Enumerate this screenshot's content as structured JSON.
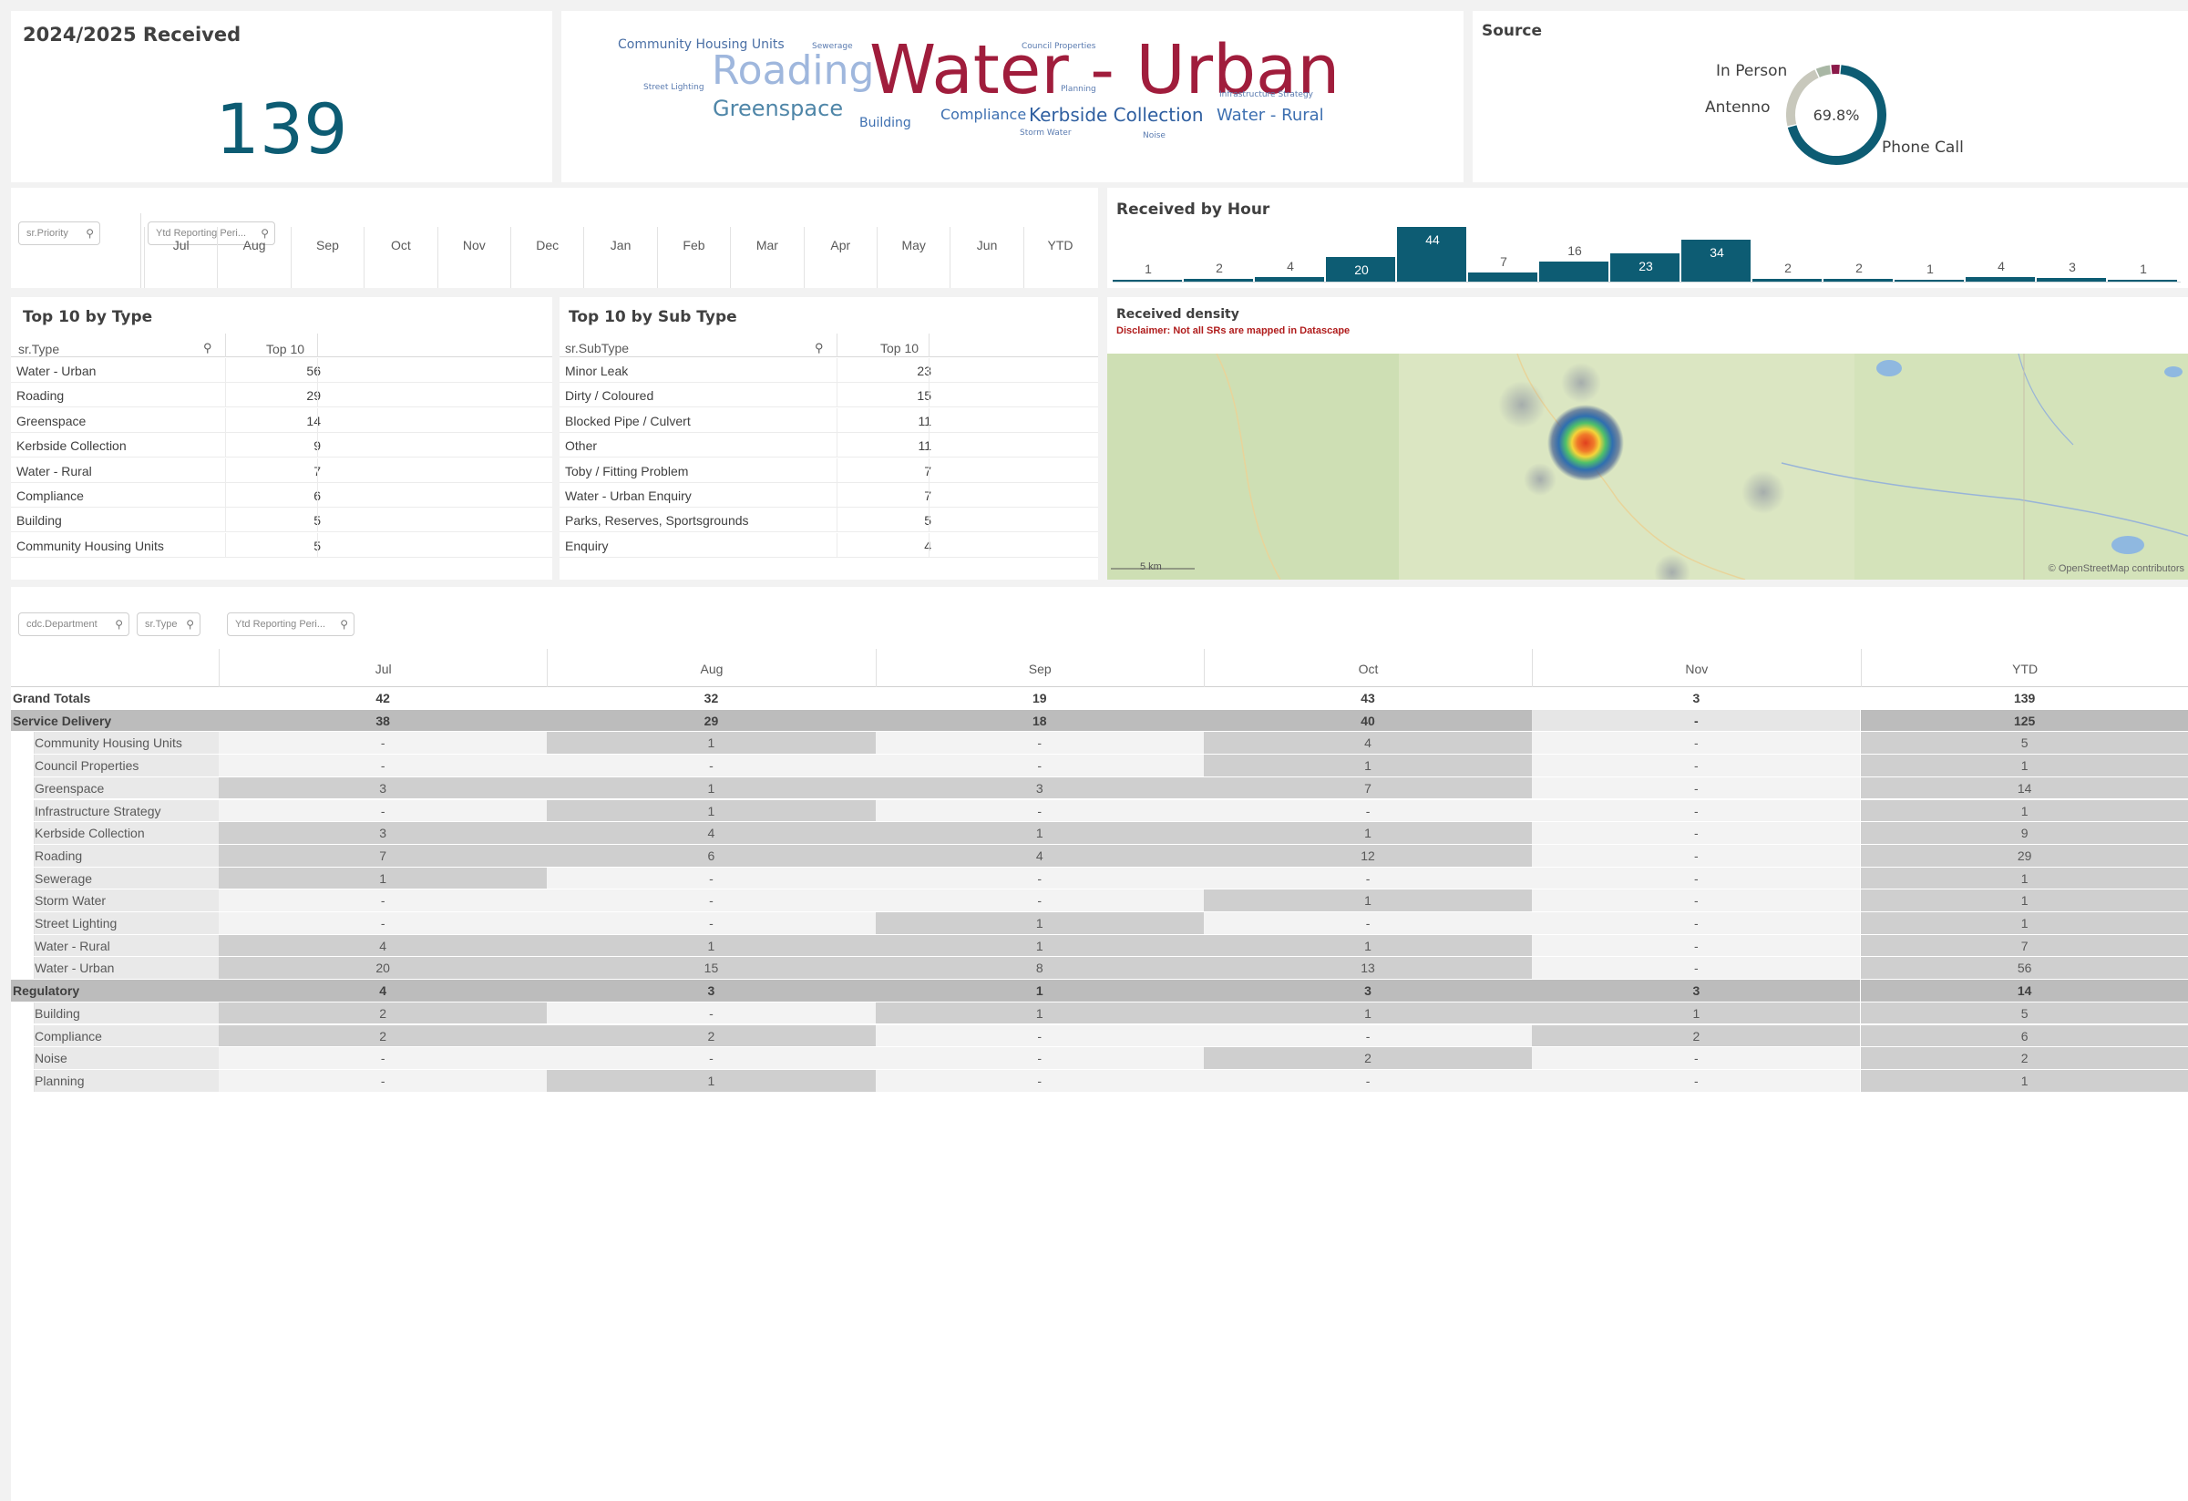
{
  "kpi": {
    "title": "2024/2025 Received",
    "value": "139"
  },
  "word_cloud": {
    "words": [
      {
        "text": "Community Housing Units",
        "color": "#4a6fa5"
      },
      {
        "text": "Sewerage",
        "color": "#5a7bb0"
      },
      {
        "text": "Council Properties",
        "color": "#5a7bb0"
      },
      {
        "text": "Street Lighting",
        "color": "#5a7bb0"
      },
      {
        "text": "Roading",
        "color": "#9fb7dd"
      },
      {
        "text": "Water - Urban",
        "color": "#a01d3c"
      },
      {
        "text": "Planning",
        "color": "#5a7bb0"
      },
      {
        "text": "Infrastructure Strategy",
        "color": "#5a7bb0"
      },
      {
        "text": "Greenspace",
        "color": "#4f86a8"
      },
      {
        "text": "Building",
        "color": "#3d6fb0"
      },
      {
        "text": "Compliance",
        "color": "#3d6fb0"
      },
      {
        "text": "Kerbside Collection",
        "color": "#2f5fa0"
      },
      {
        "text": "Water - Rural",
        "color": "#3d6fb0"
      },
      {
        "text": "Storm Water",
        "color": "#5a7bb0"
      },
      {
        "text": "Noise",
        "color": "#5a7bb0"
      }
    ]
  },
  "source": {
    "title": "Source",
    "labels": {
      "in_person": "In Person",
      "antenno": "Antenno",
      "phone_call": "Phone Call"
    },
    "center_label": "69.8%",
    "slices": [
      {
        "name": "Phone Call",
        "fraction": 0.698,
        "color": "#0d5c73"
      },
      {
        "name": "Antenno",
        "fraction": 0.22,
        "color": "#c8c8bc"
      },
      {
        "name": "In Person",
        "fraction": 0.05,
        "color": "#a9b7a5"
      },
      {
        "name": "Other",
        "fraction": 0.032,
        "color": "#8b1a4a"
      }
    ]
  },
  "filters": {
    "priority": "sr.Priority",
    "reporting_period": "Ytd Reporting Peri...",
    "department": "cdc.Department",
    "type": "sr.Type",
    "reporting_period_2": "Ytd Reporting Peri..."
  },
  "months": [
    "Jul",
    "Aug",
    "Sep",
    "Oct",
    "Nov",
    "Dec",
    "Jan",
    "Feb",
    "Mar",
    "Apr",
    "May",
    "Jun",
    "YTD"
  ],
  "histogram": {
    "title": "Received by Hour",
    "chart_data": {
      "type": "bar",
      "categories": [
        "h1",
        "h2",
        "h3",
        "h4",
        "h5",
        "h6",
        "h7",
        "h8",
        "h9",
        "h10",
        "h11",
        "h12",
        "h13",
        "h14",
        "h15"
      ],
      "values": [
        1,
        2,
        4,
        20,
        44,
        7,
        16,
        23,
        34,
        2,
        2,
        1,
        4,
        3,
        1
      ],
      "ylim": [
        0,
        44
      ]
    }
  },
  "top10_type": {
    "title": "Top 10 by Type",
    "col_name": "sr.Type",
    "col_value": "Top 10",
    "rows": [
      {
        "name": "Water - Urban",
        "value": "56"
      },
      {
        "name": "Roading",
        "value": "29"
      },
      {
        "name": "Greenspace",
        "value": "14"
      },
      {
        "name": "Kerbside Collection",
        "value": "9"
      },
      {
        "name": "Water - Rural",
        "value": "7"
      },
      {
        "name": "Compliance",
        "value": "6"
      },
      {
        "name": "Building",
        "value": "5"
      },
      {
        "name": "Community Housing Units",
        "value": "5"
      }
    ]
  },
  "top10_subtype": {
    "title": "Top 10 by Sub Type",
    "col_name": "sr.SubType",
    "col_value": "Top 10",
    "rows": [
      {
        "name": "Minor Leak",
        "value": "23"
      },
      {
        "name": "Dirty / Coloured",
        "value": "15"
      },
      {
        "name": "Blocked Pipe / Culvert",
        "value": "11"
      },
      {
        "name": "Other",
        "value": "11"
      },
      {
        "name": "Toby / Fitting Problem",
        "value": "7"
      },
      {
        "name": "Water - Urban Enquiry",
        "value": "7"
      },
      {
        "name": "Parks, Reserves, Sportsgrounds",
        "value": "5"
      },
      {
        "name": "Enquiry",
        "value": "4"
      }
    ]
  },
  "map": {
    "title": "Received density",
    "disclaimer": "Disclaimer: Not all SRs are mapped in Datascape",
    "scale": "5 km",
    "attribution": "© OpenStreetMap contributors"
  },
  "pivot": {
    "columns": [
      "Jul",
      "Aug",
      "Sep",
      "Oct",
      "Nov",
      "YTD"
    ],
    "rows": [
      {
        "label": "Grand Totals",
        "level": 0,
        "kind": "total",
        "values": [
          "42",
          "32",
          "19",
          "43",
          "3",
          "139"
        ]
      },
      {
        "label": "Service Delivery",
        "level": 0,
        "kind": "group",
        "values": [
          "38",
          "29",
          "18",
          "40",
          "-",
          "125"
        ]
      },
      {
        "label": "Community Housing Units",
        "level": 1,
        "values": [
          "-",
          "1",
          "-",
          "4",
          "-",
          "5"
        ]
      },
      {
        "label": "Council Properties",
        "level": 1,
        "values": [
          "-",
          "-",
          "-",
          "1",
          "-",
          "1"
        ]
      },
      {
        "label": "Greenspace",
        "level": 1,
        "values": [
          "3",
          "1",
          "3",
          "7",
          "-",
          "14"
        ]
      },
      {
        "label": "Infrastructure Strategy",
        "level": 1,
        "values": [
          "-",
          "1",
          "-",
          "-",
          "-",
          "1"
        ]
      },
      {
        "label": "Kerbside Collection",
        "level": 1,
        "values": [
          "3",
          "4",
          "1",
          "1",
          "-",
          "9"
        ]
      },
      {
        "label": "Roading",
        "level": 1,
        "values": [
          "7",
          "6",
          "4",
          "12",
          "-",
          "29"
        ]
      },
      {
        "label": "Sewerage",
        "level": 1,
        "values": [
          "1",
          "-",
          "-",
          "-",
          "-",
          "1"
        ]
      },
      {
        "label": "Storm Water",
        "level": 1,
        "values": [
          "-",
          "-",
          "-",
          "1",
          "-",
          "1"
        ]
      },
      {
        "label": "Street Lighting",
        "level": 1,
        "values": [
          "-",
          "-",
          "1",
          "-",
          "-",
          "1"
        ]
      },
      {
        "label": "Water - Rural",
        "level": 1,
        "values": [
          "4",
          "1",
          "1",
          "1",
          "-",
          "7"
        ]
      },
      {
        "label": "Water - Urban",
        "level": 1,
        "values": [
          "20",
          "15",
          "8",
          "13",
          "-",
          "56"
        ]
      },
      {
        "label": "Regulatory",
        "level": 0,
        "kind": "group",
        "values": [
          "4",
          "3",
          "1",
          "3",
          "3",
          "14"
        ]
      },
      {
        "label": "Building",
        "level": 1,
        "values": [
          "2",
          "-",
          "1",
          "1",
          "1",
          "5"
        ]
      },
      {
        "label": "Compliance",
        "level": 1,
        "values": [
          "2",
          "2",
          "-",
          "-",
          "2",
          "6"
        ]
      },
      {
        "label": "Noise",
        "level": 1,
        "values": [
          "-",
          "-",
          "-",
          "2",
          "-",
          "2"
        ]
      },
      {
        "label": "Planning",
        "level": 1,
        "values": [
          "-",
          "1",
          "-",
          "-",
          "-",
          "1"
        ]
      }
    ]
  }
}
